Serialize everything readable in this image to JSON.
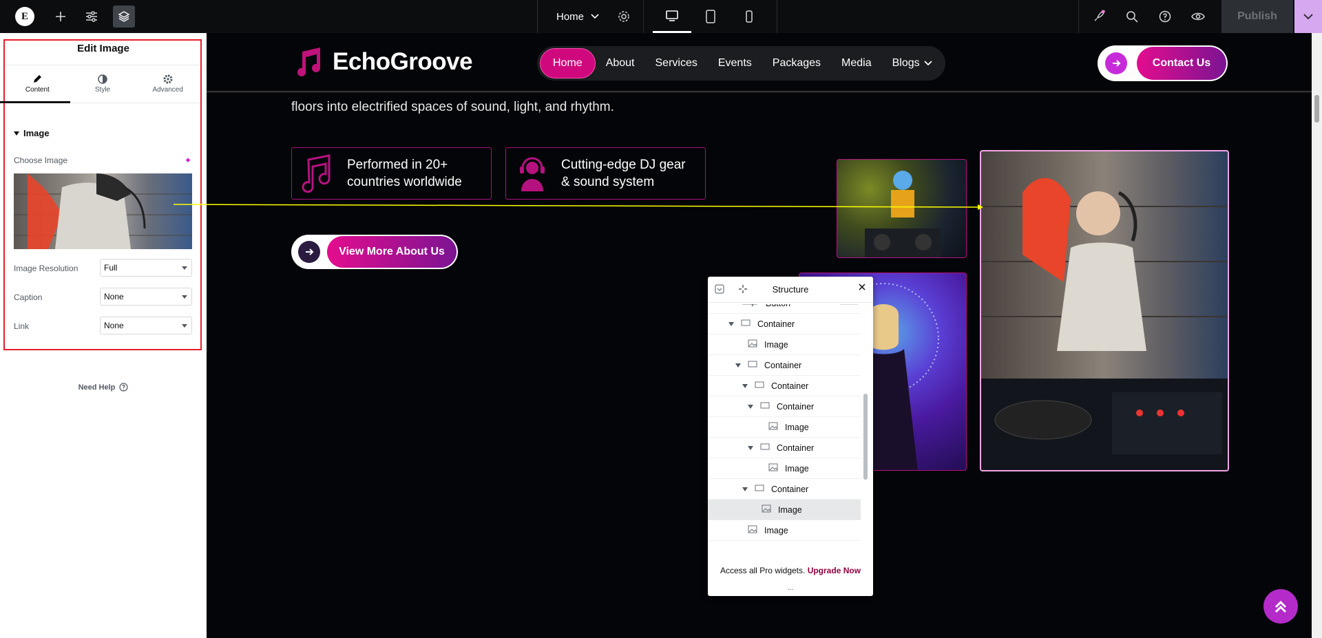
{
  "topbar": {
    "logo_text": "E",
    "page_name": "Home",
    "publish_label": "Publish",
    "icons": [
      "elementor-logo-icon",
      "add-icon",
      "sliders-icon",
      "layers-icon",
      "chevron-down-icon",
      "gear-icon",
      "desktop-icon",
      "tablet-icon",
      "mobile-icon",
      "rocket-icon",
      "search-icon",
      "question-icon",
      "eye-icon"
    ]
  },
  "panel": {
    "title": "Edit Image",
    "tabs": [
      {
        "label": "Content",
        "icon": "pencil-icon"
      },
      {
        "label": "Style",
        "icon": "contrast-icon"
      },
      {
        "label": "Advanced",
        "icon": "gear-icon"
      }
    ],
    "section_title": "Image",
    "choose_image_label": "Choose Image",
    "controls": [
      {
        "label": "Image Resolution",
        "value": "Full"
      },
      {
        "label": "Caption",
        "value": "None"
      },
      {
        "label": "Link",
        "value": "None"
      }
    ],
    "need_help": "Need Help"
  },
  "site": {
    "brand": "EchoGroove",
    "nav": [
      "Home",
      "About",
      "Services",
      "Events",
      "Packages",
      "Media",
      "Blogs"
    ],
    "contact_label": "Contact Us",
    "hero_text": "floors into electrified spaces of sound, light, and rhythm.",
    "features": [
      {
        "line1": "Performed in 20+",
        "line2": "countries worldwide"
      },
      {
        "line1": "Cutting-edge DJ gear",
        "line2": "& sound system"
      }
    ],
    "about_button": "View More About Us"
  },
  "structure": {
    "title": "Structure",
    "exit_badge": "EXIT",
    "rows": [
      {
        "label": "Button",
        "caret": false,
        "icon": "button-icon",
        "selected": false
      },
      {
        "label": "Container",
        "caret": true,
        "icon": "container-icon",
        "selected": false
      },
      {
        "label": "Image",
        "caret": false,
        "icon": "image-icon",
        "selected": false
      },
      {
        "label": "Container",
        "caret": true,
        "icon": "container-icon",
        "selected": false
      },
      {
        "label": "Container",
        "caret": true,
        "icon": "container-icon",
        "selected": false
      },
      {
        "label": "Container",
        "caret": true,
        "icon": "container-icon",
        "selected": false
      },
      {
        "label": "Image",
        "caret": false,
        "icon": "image-icon",
        "selected": false
      },
      {
        "label": "Container",
        "caret": true,
        "icon": "container-icon",
        "selected": false
      },
      {
        "label": "Image",
        "caret": false,
        "icon": "image-icon",
        "selected": false
      },
      {
        "label": "Container",
        "caret": true,
        "icon": "container-icon",
        "selected": false
      },
      {
        "label": "Image",
        "caret": false,
        "icon": "image-icon",
        "selected": true
      },
      {
        "label": "Image",
        "caret": false,
        "icon": "image-icon",
        "selected": false
      }
    ],
    "upgrade_text": "Access all Pro widgets.",
    "upgrade_link": "Upgrade Now",
    "dots": "..."
  },
  "colors": {
    "accent": "#cf097d",
    "highlight": "#e41e2b",
    "connector": "#ffff00"
  }
}
